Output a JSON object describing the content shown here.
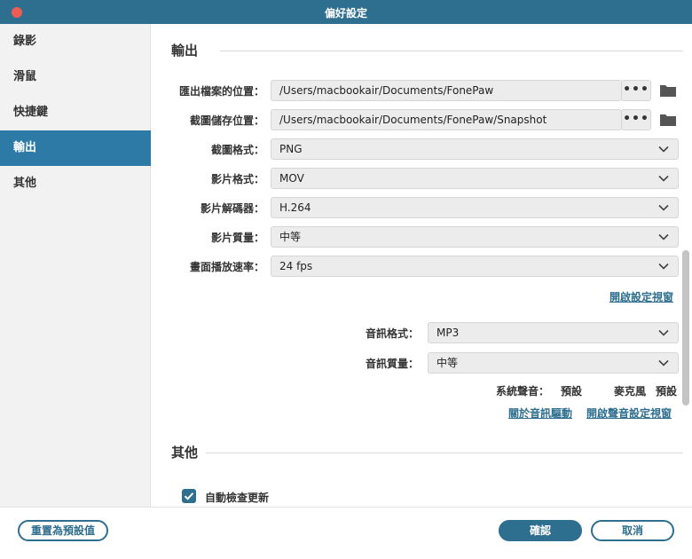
{
  "window": {
    "title": "偏好設定"
  },
  "sidebar": {
    "items": [
      {
        "label": "錄影"
      },
      {
        "label": "滑鼠"
      },
      {
        "label": "快捷鍵"
      },
      {
        "label": "輸出",
        "active": true
      },
      {
        "label": "其他"
      }
    ]
  },
  "output": {
    "section_title": "輸出",
    "export_location": {
      "label": "匯出檔案的位置：",
      "value": "/Users/macbookair/Documents/FonePaw"
    },
    "screenshot_location": {
      "label": "截圖儲存位置：",
      "value": "/Users/macbookair/Documents/FonePaw/Snapshot"
    },
    "screenshot_format": {
      "label": "截圖格式：",
      "value": "PNG"
    },
    "video_format": {
      "label": "影片格式：",
      "value": "MOV"
    },
    "video_codec": {
      "label": "影片解碼器：",
      "value": "H.264"
    },
    "video_quality": {
      "label": "影片質量：",
      "value": "中等"
    },
    "frame_rate": {
      "label": "畫面播放速率：",
      "value": "24 fps"
    },
    "open_settings_link": "開啟設定視窗",
    "audio_format": {
      "label": "音訊格式：",
      "value": "MP3"
    },
    "audio_quality": {
      "label": "音訊質量：",
      "value": "中等"
    },
    "system_sound": {
      "label": "系統聲音：",
      "value": "預設"
    },
    "microphone": {
      "label": "麥克風",
      "value": "預設"
    },
    "about_audio_driver_link": "關於音訊驅動",
    "open_sound_settings_link": "開啟聲音設定視窗",
    "dots_label": "•••"
  },
  "other": {
    "section_title": "其他",
    "auto_update": {
      "label": "自動檢查更新",
      "checked": true
    }
  },
  "footer": {
    "reset_label": "重置為預設值",
    "confirm_label": "確認",
    "cancel_label": "取消"
  },
  "colors": {
    "accent": "#2e6e8f",
    "sidebar_active": "#2e7aa6",
    "close_dot": "#ee5c55"
  }
}
